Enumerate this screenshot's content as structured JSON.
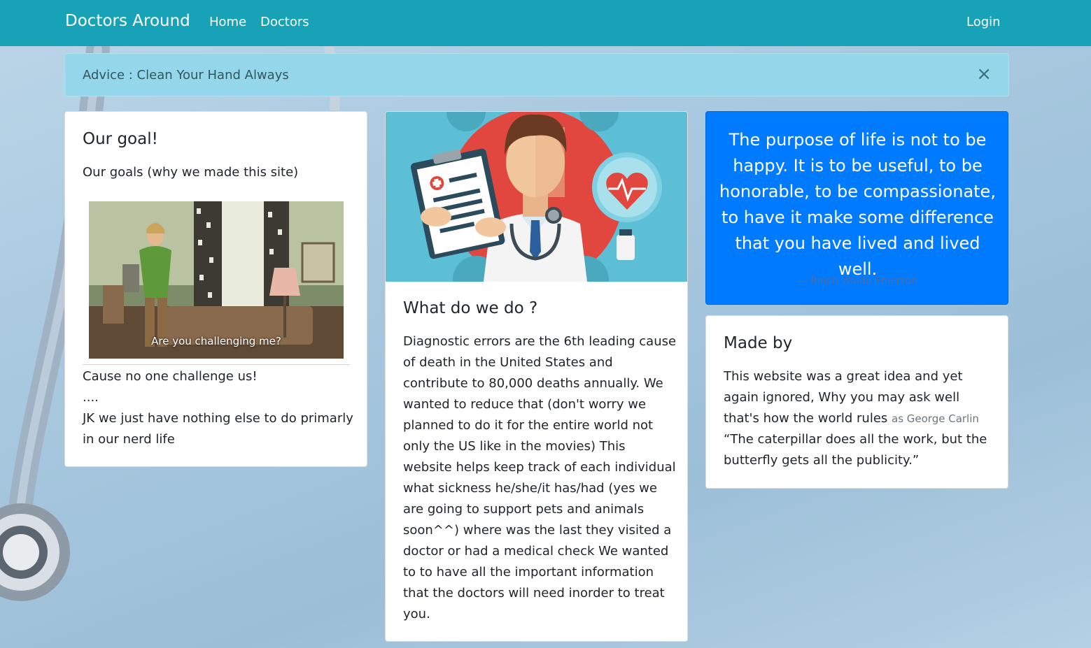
{
  "navbar": {
    "brand": "Doctors Around",
    "home": "Home",
    "doctors": "Doctors",
    "login": "Login",
    "color": "#17a2b8"
  },
  "alert": {
    "text": "Advice : Clean Your Hand Always",
    "close": "×"
  },
  "goal_card": {
    "title": "Our goal!",
    "subtitle": "Our goals (why we made this site)",
    "gif_caption": "Are you challenging me?",
    "line1": "Cause no one challenge us!",
    "line2": "....",
    "line3": "JK we just have nothing else to do primarly in our nerd life"
  },
  "what_card": {
    "title": "What do we do ?",
    "text": "Diagnostic errors are the 6th leading cause of death in the United States and contribute to 80,000 deaths annually. We wanted to reduce that (don't worry we planned to do it for the entire world not only the US like in the movies) This website helps keep track of each individual what sickness he/she/it has/had (yes we are going to support pets and animals soon^^) where was the last they visited a doctor or had a medical check We wanted to to have all the important information that the doctors will need inorder to treat you."
  },
  "quote_card": {
    "quote": "The purpose of life is not to be happy. It is to be useful, to be honorable, to be compassionate, to have it make some difference that you have lived and lived well.",
    "author": "— Ralph Waldo Emerson",
    "color": "#007bff"
  },
  "made_by_card": {
    "title": "Made by",
    "text_before": "This website was a great idea and yet again ignored, Why you may ask well that's how the world rules ",
    "attribution": "as George Carlin",
    "text_after": " “The caterpillar does all the work, but the butterfly gets all the publicity.”"
  }
}
